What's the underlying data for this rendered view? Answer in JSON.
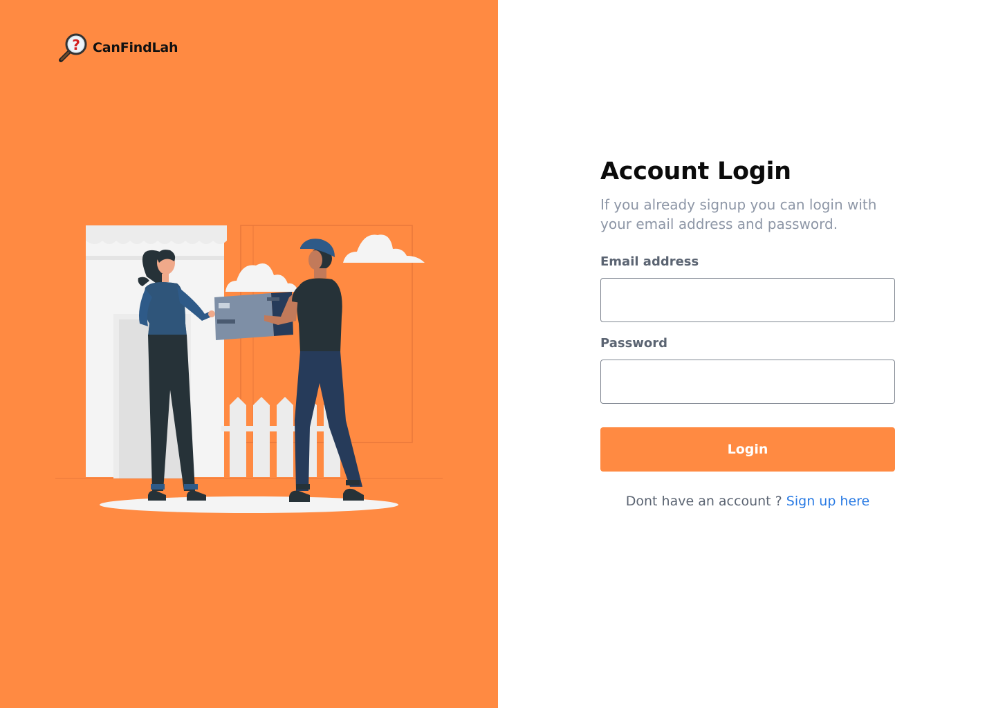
{
  "brand": {
    "name": "CanFindLah",
    "logo_icon": "magnifier-question-icon",
    "accent_color": "#FF8A42"
  },
  "illustration": {
    "icon": "delivery-handover-illustration"
  },
  "login": {
    "title": "Account Login",
    "subtitle": "If you already signup you can login with your email address and password.",
    "email_label": "Email address",
    "email_value": "",
    "email_placeholder": "",
    "password_label": "Password",
    "password_value": "",
    "password_placeholder": "",
    "submit_label": "Login",
    "signup_prompt": "Dont have an account ?",
    "signup_link": "Sign up here",
    "link_color": "#2A7BE4"
  }
}
